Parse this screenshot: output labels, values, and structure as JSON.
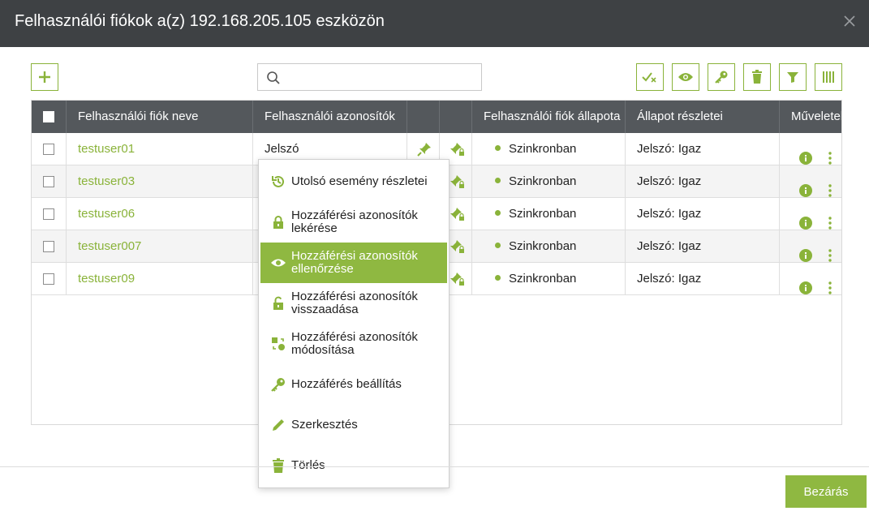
{
  "dialog": {
    "title": "Felhasználói fiókok a(z) 192.168.205.105 eszközön",
    "close_icon": "close-icon"
  },
  "toolbar": {
    "add_icon": "plus-icon",
    "search_placeholder": "",
    "search_value": "",
    "right_icons": [
      "check-x-icon",
      "eye-icon",
      "key-icon",
      "trash-icon",
      "filter-icon",
      "columns-icon"
    ]
  },
  "table": {
    "headers": {
      "name": "Felhasználói fiók neve",
      "credentials": "Felhasználói azonosítók",
      "status": "Felhasználói fiók állapota",
      "status_details": "Állapot részletei",
      "actions": "Műveletek"
    },
    "rows": [
      {
        "name": "testuser01",
        "credential": "Jelszó",
        "status": "Szinkronban",
        "detail": "Jelszó: Igaz"
      },
      {
        "name": "testuser03",
        "credential": "",
        "status": "Szinkronban",
        "detail": "Jelszó: Igaz"
      },
      {
        "name": "testuser06",
        "credential": "",
        "status": "Szinkronban",
        "detail": "Jelszó: Igaz"
      },
      {
        "name": "testuser007",
        "credential": "",
        "status": "Szinkronban",
        "detail": "Jelszó: Igaz"
      },
      {
        "name": "testuser09",
        "credential": "",
        "status": "Szinkronban",
        "detail": "Jelszó: Igaz"
      }
    ]
  },
  "context_menu": {
    "items": [
      {
        "label": "Utolsó esemény részletei",
        "icon": "history-icon",
        "active": false
      },
      {
        "label": "Hozzáférési azonosítók lekérése",
        "icon": "lock-icon",
        "active": false
      },
      {
        "label": "Hozzáférési azonosítók ellenőrzése",
        "icon": "eye-icon",
        "active": true
      },
      {
        "label": "Hozzáférési azonosítók visszaadása",
        "icon": "unlock-icon",
        "active": false
      },
      {
        "label": "Hozzáférési azonosítók módosítása",
        "icon": "change-icon",
        "active": false
      },
      {
        "label": "Hozzáférés beállítás",
        "icon": "key-icon",
        "active": false
      },
      {
        "label": "Szerkesztés",
        "icon": "pencil-icon",
        "active": false
      },
      {
        "label": "Törlés",
        "icon": "trash-icon",
        "active": false
      }
    ]
  },
  "footer": {
    "close_label": "Bezárás"
  },
  "colors": {
    "accent": "#8fb841",
    "titlebar": "#3e4144",
    "header": "#54585c"
  }
}
